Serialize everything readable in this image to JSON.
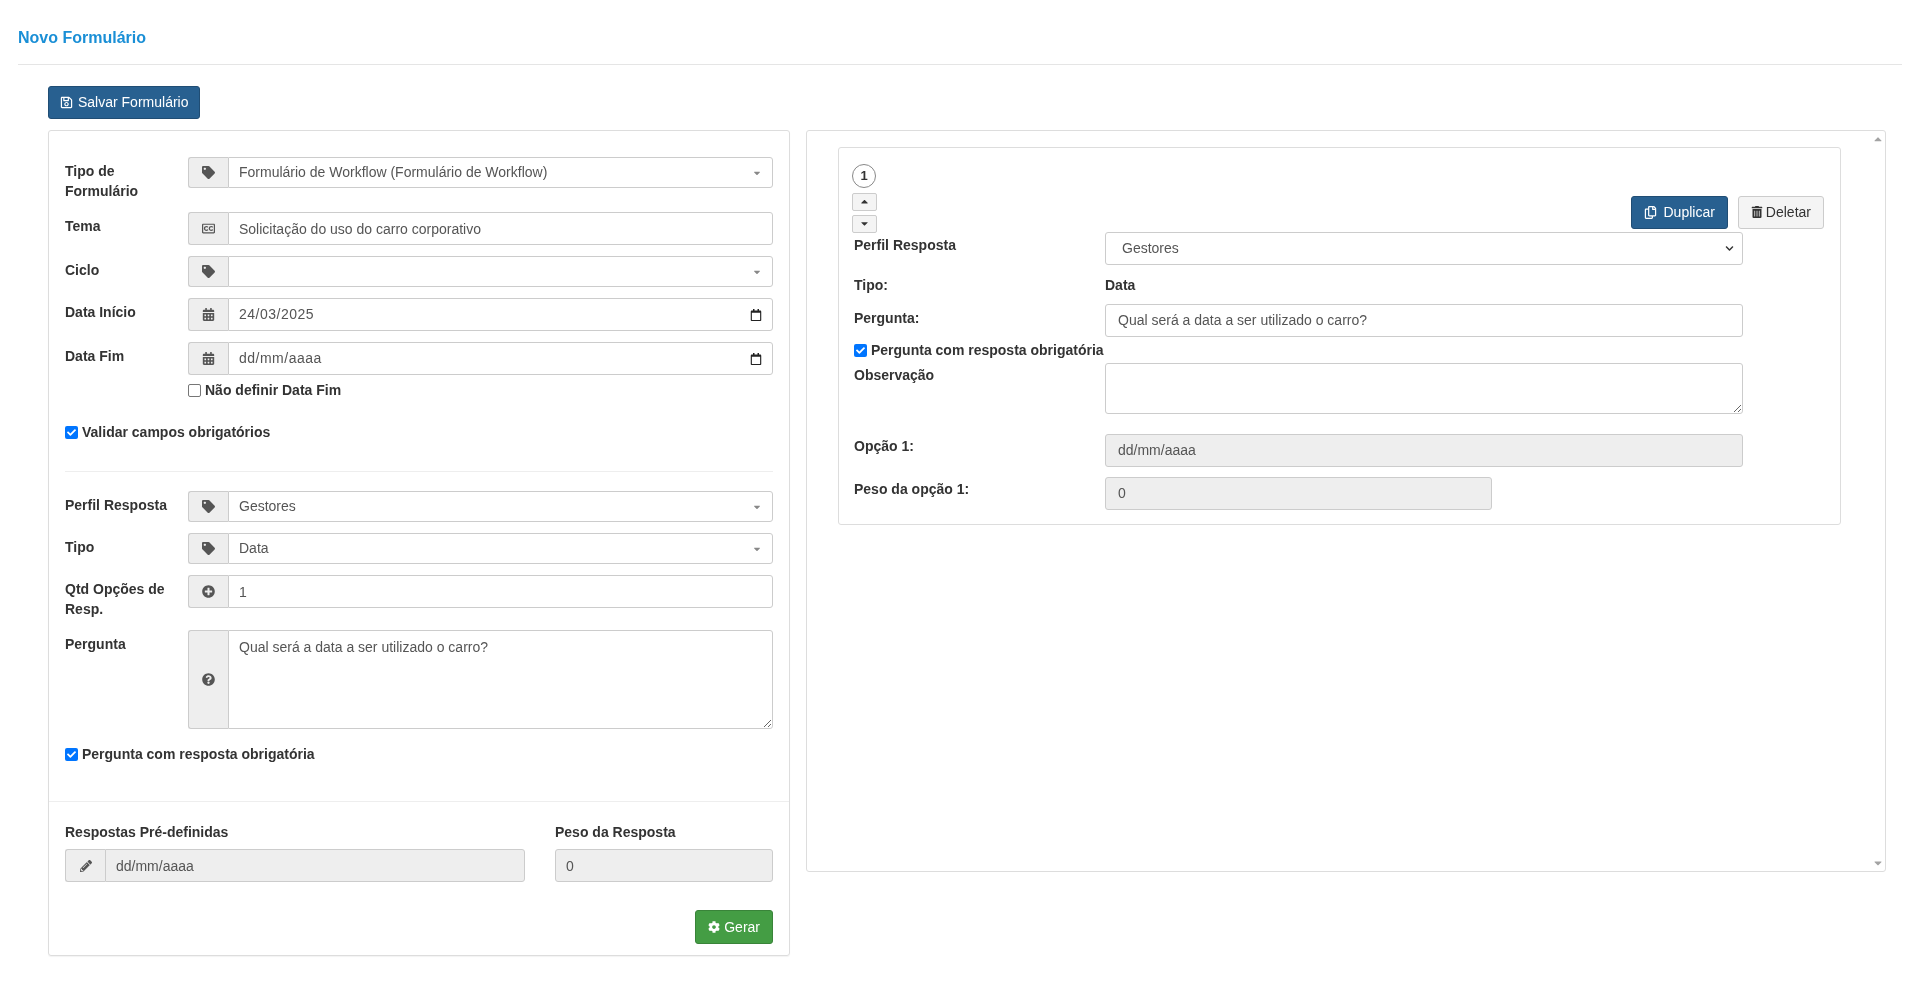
{
  "page_title": "Novo Formulário",
  "save_button": "Salvar Formulário",
  "form": {
    "fields": [
      {
        "kind": "select",
        "label": "Tipo de Formulário",
        "value": "Formulário de Workflow (Formulário de Workflow)"
      },
      {
        "kind": "text",
        "label": "Tema",
        "value": "Solicitação do uso do carro corporativo"
      },
      {
        "kind": "select",
        "label": "Ciclo"
      },
      {
        "kind": "date",
        "label": "Data Início",
        "value": "24/03/2025"
      },
      {
        "kind": "date",
        "label": "Data Fim",
        "placeholder": "dd/mm/aaaa"
      }
    ],
    "no_end_date": {
      "label": "Não definir Data Fim",
      "checked": false
    },
    "validate": {
      "label": "Validar campos obrigatórios",
      "checked": true
    }
  },
  "question_form": {
    "fields": [
      {
        "kind": "select",
        "label": "Perfil Resposta",
        "value": "Gestores"
      },
      {
        "kind": "select",
        "label": "Tipo",
        "value": "Data"
      },
      {
        "kind": "number",
        "label": "Qtd Opções de Resp.",
        "value": "1"
      },
      {
        "kind": "textarea",
        "label": "Pergunta",
        "value": "Qual será a data a ser utilizado o carro?"
      }
    ],
    "required": {
      "label": "Pergunta com resposta obrigatória",
      "checked": true
    }
  },
  "predefined": {
    "answers_label": "Respostas Pré-definidas",
    "answer_value": "dd/mm/aaaa",
    "weight_label": "Peso da Resposta",
    "weight_value": "0",
    "generate_button": "Gerar"
  },
  "questions": [
    {
      "number": "1",
      "duplicate_button": "Duplicar",
      "delete_button": "Deletar",
      "profile_label": "Perfil Resposta",
      "profile_value": "Gestores",
      "type_label": "Tipo:",
      "type_value": "Data",
      "question_label": "Pergunta:",
      "question_value": "Qual será a data a ser utilizado o carro?",
      "required": {
        "label": "Pergunta com resposta obrigatória",
        "checked": true
      },
      "note_label": "Observação",
      "options": [
        {
          "label": "Opção 1:",
          "value": "dd/mm/aaaa",
          "weight_label": "Peso da opção 1:",
          "weight_value": "0"
        }
      ]
    }
  ]
}
